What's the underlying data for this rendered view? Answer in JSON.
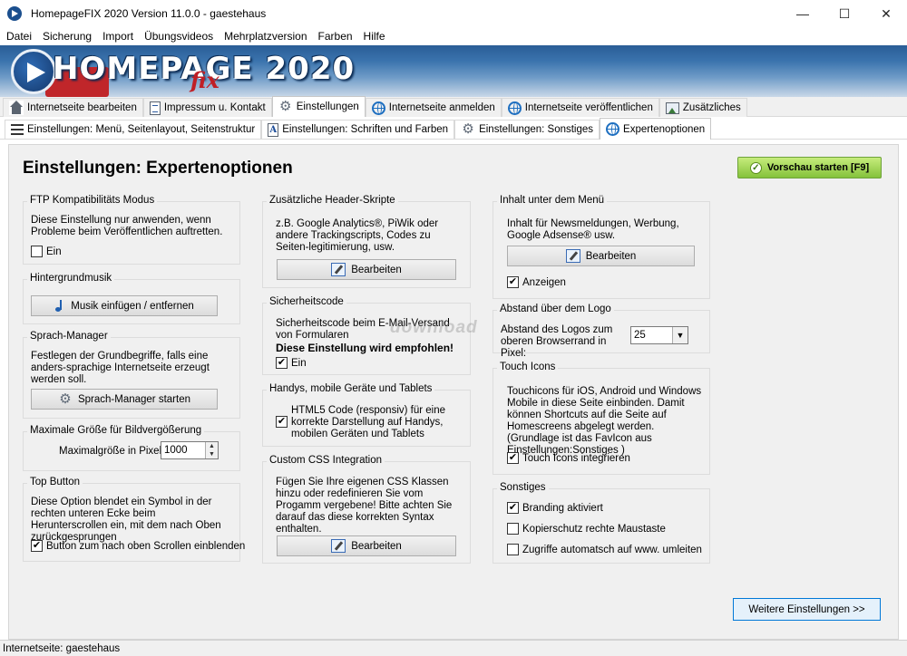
{
  "window": {
    "title": "HomepageFIX 2020 Version 11.0.0 - gaestehaus",
    "minimize": "—",
    "maximize": "☐",
    "close": "✕"
  },
  "menu": [
    "Datei",
    "Sicherung",
    "Import",
    "Übungsvideos",
    "Mehrplatzversion",
    "Farben",
    "Hilfe"
  ],
  "banner": {
    "title": "HOMEPAGE",
    "year": "2020",
    "fix": "fix"
  },
  "tabs_main": [
    {
      "label": "Internetseite bearbeiten",
      "icon": "home-icon"
    },
    {
      "label": "Impressum u. Kontakt",
      "icon": "document-icon"
    },
    {
      "label": "Einstellungen",
      "icon": "gear-icon",
      "active": true
    },
    {
      "label": "Internetseite anmelden",
      "icon": "globe-icon"
    },
    {
      "label": "Internetseite veröffentlichen",
      "icon": "globe-icon"
    },
    {
      "label": "Zusätzliches",
      "icon": "picture-icon"
    }
  ],
  "tabs_sub": [
    {
      "label": "Einstellungen: Menü, Seitenlayout, Seitenstruktur",
      "icon": "menu-icon"
    },
    {
      "label": "Einstellungen: Schriften und Farben",
      "icon": "font-icon"
    },
    {
      "label": "Einstellungen: Sonstiges",
      "icon": "gear-icon"
    },
    {
      "label": "Expertenoptionen",
      "icon": "globe-icon",
      "active": true
    }
  ],
  "page": {
    "title": "Einstellungen: Expertenoptionen",
    "preview_button": "Vorschau starten [F9]",
    "more_settings_button": "Weitere Einstellungen >>",
    "watermark": "download"
  },
  "ftp": {
    "title": "FTP Kompatibilitäts Modus",
    "text": "Diese Einstellung nur anwenden, wenn Probleme beim Veröffentlichen auftretten.",
    "checkbox": "Ein",
    "checked": false
  },
  "music": {
    "title": "Hintergrundmusik",
    "button": "Musik einfügen / entfernen"
  },
  "language": {
    "title": "Sprach-Manager",
    "text": "Festlegen der Grundbegriffe, falls eine anders-sprachige Internetseite erzeugt werden soll.",
    "button": "Sprach-Manager starten"
  },
  "image_zoom": {
    "title": "Maximale Größe für Bildvergößerung",
    "label": "Maximalgröße in Pixel",
    "value": "1000"
  },
  "top_button": {
    "title": "Top Button",
    "text": "Diese Option blendet ein Symbol in der rechten unteren Ecke beim Herunterscrollen ein, mit dem nach Oben zurückgesprungen",
    "checkbox": "Button zum nach oben Scrollen einblenden",
    "checked": true
  },
  "header_scripts": {
    "title": "Zusätzliche Header-Skripte",
    "text": "z.B. Google Analytics®, PiWik oder andere Trackingscripts, Codes zu Seiten-legitimierung, usw.",
    "button": "Bearbeiten"
  },
  "security": {
    "title": "Sicherheitscode",
    "text": "Sicherheitscode beim E-Mail-Versand von Formularen",
    "recommend": "Diese Einstellung wird empfohlen!",
    "checkbox": "Ein",
    "checked": true
  },
  "mobile": {
    "title": "Handys, mobile Geräte und Tablets",
    "checkbox": "HTML5 Code (responsiv) für eine korrekte Darstellung auf Handys, mobilen Geräten und Tablets",
    "checked": true
  },
  "custom_css": {
    "title": "Custom CSS Integration",
    "text": "Fügen Sie Ihre eigenen CSS Klassen hinzu oder redefinieren Sie vom Progamm vergebene! Bitte achten Sie darauf das diese korrekten Syntax enthalten.",
    "button": "Bearbeiten"
  },
  "under_menu": {
    "title": "Inhalt unter dem Menü",
    "text": "Inhalt für Newsmeldungen, Werbung, Google Adsense® usw.",
    "button": "Bearbeiten",
    "checkbox": "Anzeigen",
    "checked": true
  },
  "logo_spacing": {
    "title": "Abstand über dem Logo",
    "label": "Abstand des Logos zum oberen Browserrand in Pixel:",
    "value": "25"
  },
  "touch_icons": {
    "title": "Touch Icons",
    "text": "Touchicons für iOS, Android und Windows Mobile in diese Seite einbinden. Damit können Shortcuts auf die Seite auf Homescreens abgelegt werden. (Grundlage ist das FavIcon aus Einstellungen:Sonstiges )",
    "checkbox": "Touch Icons integrieren",
    "checked": true
  },
  "misc": {
    "title": "Sonstiges",
    "items": [
      {
        "label": "Branding aktiviert",
        "checked": true
      },
      {
        "label": "Kopierschutz rechte Maustaste",
        "checked": false
      },
      {
        "label": "Zugriffe automatsch auf www. umleiten",
        "checked": false
      }
    ]
  },
  "status": {
    "text": "Internetseite: gaestehaus"
  },
  "colors": {
    "accent_green": "#84c23b",
    "banner_blue": "#2a5d96",
    "focus_blue": "#0078d7"
  }
}
